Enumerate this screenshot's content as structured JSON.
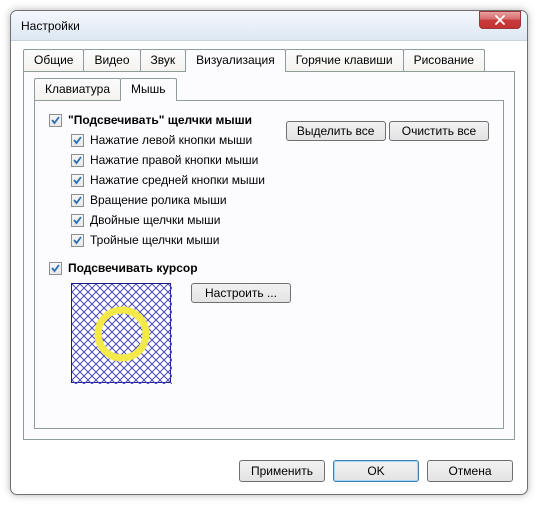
{
  "window": {
    "title": "Настройки"
  },
  "tabs": {
    "general": "Общие",
    "video": "Видео",
    "sound": "Звук",
    "visualization": "Визуализация",
    "hotkeys": "Горячие клавиши",
    "drawing": "Рисование"
  },
  "subtabs": {
    "keyboard": "Клавиатура",
    "mouse": "Мышь"
  },
  "checks": {
    "highlight_clicks": "\"Подсвечивать\" щелчки мыши",
    "left": "Нажатие левой кнопки мыши",
    "right": "Нажатие правой кнопки мыши",
    "middle": "Нажатие средней кнопки мыши",
    "wheel": "Вращение ролика мыши",
    "double": "Двойные щелчки мыши",
    "triple": "Тройные щелчки мыши",
    "highlight_cursor": "Подсвечивать курсор"
  },
  "side": {
    "select_all": "Выделить все",
    "clear_all": "Очистить все"
  },
  "configure": "Настроить ...",
  "footer": {
    "apply": "Применить",
    "ok": "OK",
    "cancel": "Отмена"
  }
}
